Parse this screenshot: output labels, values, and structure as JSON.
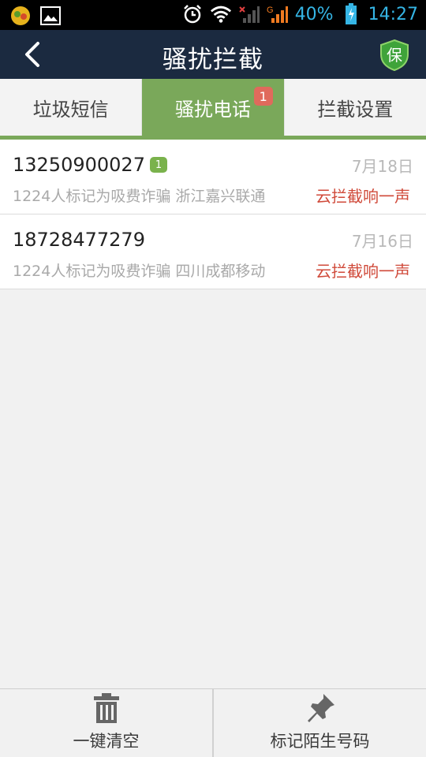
{
  "status_bar": {
    "battery": "40%",
    "time": "14:27",
    "signal_label": "G"
  },
  "header": {
    "title": "骚扰拦截",
    "back_icon": "back-arrow-icon",
    "shield_label": "保"
  },
  "tabs": [
    {
      "label": "垃圾短信",
      "active": false
    },
    {
      "label": "骚扰电话",
      "active": true,
      "badge": "1"
    },
    {
      "label": "拦截设置",
      "active": false
    }
  ],
  "calls": [
    {
      "number": "13250900027",
      "count": "1",
      "date": "7月18日",
      "description": "1224人标记为吸费诈骗  浙江嘉兴联通",
      "status": "云拦截响一声"
    },
    {
      "number": "18728477279",
      "date": "7月16日",
      "description": "1224人标记为吸费诈骗  四川成都移动",
      "status": "云拦截响一声"
    }
  ],
  "bottom": {
    "clear_label": "一键清空",
    "mark_label": "标记陌生号码"
  },
  "colors": {
    "accent_green": "#7aa85a",
    "header_bg": "#1b2a40",
    "status_red": "#d04a3a"
  }
}
